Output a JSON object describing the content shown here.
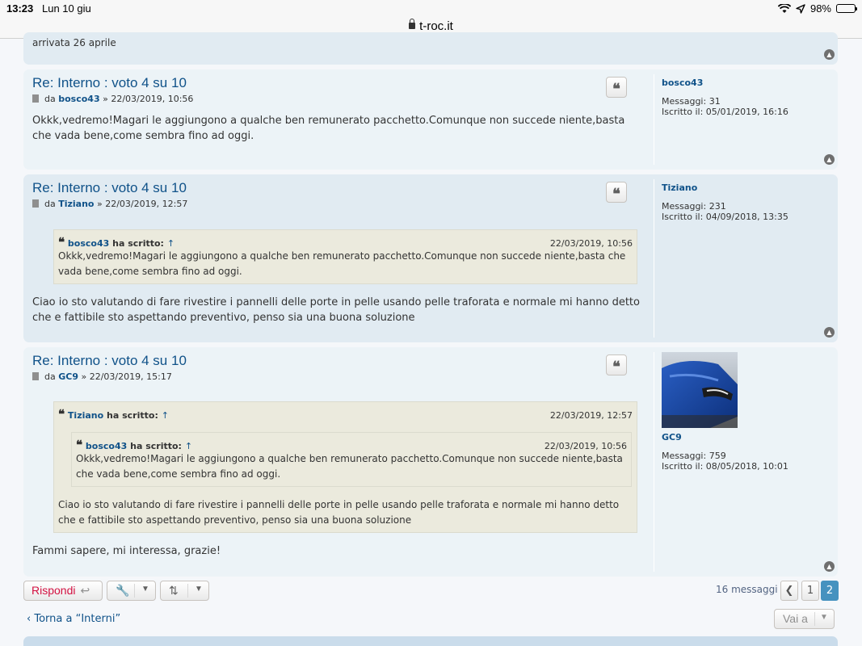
{
  "status_bar": {
    "time": "13:23",
    "date": "Lun 10 giu",
    "battery": "98%",
    "battery_level": 0.98
  },
  "browser": {
    "url": "t-roc.it"
  },
  "previous_post_tail": {
    "text": "arrivata 26 aprile"
  },
  "posts": [
    {
      "title": "Re: Interno : voto 4 su 10",
      "by": "da",
      "author": "bosco43",
      "datetime": "» 22/03/2019, 10:56",
      "body": "Okkk,vedremo!Magari le aggiungono a qualche ben remunerato pacchetto.Comunque non succede niente,basta che vada bene,come sembra fino ad oggi.",
      "profile": {
        "username": "bosco43",
        "messages_label": "Messaggi:",
        "messages": "31",
        "joined_label": "Iscritto il:",
        "joined": "05/01/2019, 16:16"
      }
    },
    {
      "title": "Re: Interno : voto 4 su 10",
      "by": "da",
      "author": "Tiziano",
      "datetime": "» 22/03/2019, 12:57",
      "quote": {
        "user": "bosco43",
        "wrote": "ha scritto:",
        "arrow": "↑",
        "date": "22/03/2019, 10:56",
        "text": "Okkk,vedremo!Magari le aggiungono a qualche ben remunerato pacchetto.Comunque non succede niente,basta che vada bene,come sembra fino ad oggi."
      },
      "body": "Ciao io sto valutando di fare rivestire i pannelli delle porte in pelle usando pelle traforata e normale mi hanno detto che e fattibile sto aspettando preventivo, penso sia una buona soluzione",
      "profile": {
        "username": "Tiziano",
        "messages_label": "Messaggi:",
        "messages": "231",
        "joined_label": "Iscritto il:",
        "joined": "04/09/2018, 13:35"
      }
    },
    {
      "title": "Re: Interno : voto 4 su 10",
      "by": "da",
      "author": "GC9",
      "datetime": "» 22/03/2019, 15:17",
      "quote": {
        "user": "Tiziano",
        "wrote": "ha scritto:",
        "arrow": "↑",
        "date": "22/03/2019, 12:57",
        "text": "Ciao io sto valutando di fare rivestire i pannelli delle porte in pelle usando pelle traforata e normale mi hanno detto che e fattibile sto aspettando preventivo, penso sia una buona soluzione",
        "nested": {
          "user": "bosco43",
          "wrote": "ha scritto:",
          "arrow": "↑",
          "date": "22/03/2019, 10:56",
          "text": "Okkk,vedremo!Magari le aggiungono a qualche ben remunerato pacchetto.Comunque non succede niente,basta che vada bene,come sembra fino ad oggi."
        }
      },
      "body": "Fammi sapere, mi interessa, grazie!",
      "profile": {
        "username": "GC9",
        "messages_label": "Messaggi:",
        "messages": "759",
        "joined_label": "Iscritto il:",
        "joined": "08/05/2018, 10:01",
        "avatar": "blue-car-avatar"
      }
    }
  ],
  "actions": {
    "reply_label": "Rispondi",
    "message_count": "16 messaggi",
    "pages": [
      "1",
      "2"
    ],
    "current_page": "2",
    "back_link": "Torna a “Interni”",
    "jump_label": "Vai a"
  },
  "colors": {
    "link": "#105289",
    "post_bg_1": "#e1ebf2",
    "post_bg_2": "#ecf3f7",
    "quote_bg": "#ebeadd",
    "reply": "#d31141",
    "active_page": "#4692bf"
  }
}
